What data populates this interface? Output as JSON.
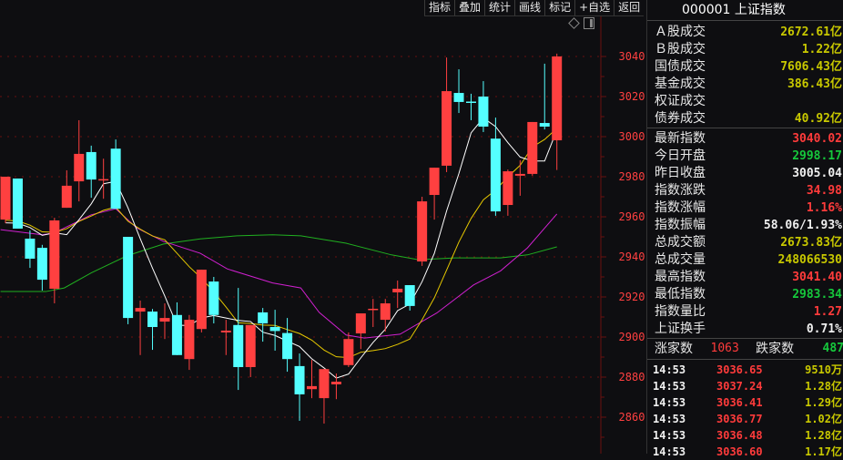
{
  "toolbar": {
    "buttons": [
      "指标",
      "叠加",
      "统计",
      "画线",
      "标记",
      "+自选",
      "返回"
    ]
  },
  "panel": {
    "title": "000001 上证指数",
    "trade_rows": [
      {
        "label": "Ａ股成交",
        "value": "2672.61亿"
      },
      {
        "label": "Ｂ股成交",
        "value": "1.22亿"
      },
      {
        "label": "国债成交",
        "value": "7606.43亿"
      },
      {
        "label": "基金成交",
        "value": "386.43亿"
      },
      {
        "label": "权证成交",
        "value": ""
      },
      {
        "label": "债券成交",
        "value": "40.92亿"
      }
    ],
    "index_rows": [
      {
        "label": "最新指数",
        "value": "3040.02",
        "color": "r"
      },
      {
        "label": "今日开盘",
        "value": "2998.17",
        "color": "g"
      },
      {
        "label": "昨日收盘",
        "value": "3005.04",
        "color": "w"
      },
      {
        "label": "指数涨跌",
        "value": "34.98",
        "color": "r"
      },
      {
        "label": "指数涨幅",
        "value": "1.16%",
        "color": "r"
      },
      {
        "label": "指数振幅",
        "value": "58.06/1.93%",
        "color": "w"
      },
      {
        "label": "总成交额",
        "value": "2673.83亿",
        "color": "y"
      },
      {
        "label": "总成交量",
        "value": "248066530",
        "color": "y"
      },
      {
        "label": "最高指数",
        "value": "3041.40",
        "color": "r"
      },
      {
        "label": "最低指数",
        "value": "2983.34",
        "color": "g"
      },
      {
        "label": "指数量比",
        "value": "1.27",
        "color": "r"
      },
      {
        "label": "上证换手",
        "value": "0.71%",
        "color": "w"
      }
    ],
    "advance_label": "涨家数",
    "advance": "1063",
    "decline_label": "跌家数",
    "decline": "487",
    "ticks": [
      {
        "time": "14:53",
        "price": "3036.65",
        "vol": "9510万"
      },
      {
        "time": "14:53",
        "price": "3037.24",
        "vol": "1.28亿"
      },
      {
        "time": "14:53",
        "price": "3036.41",
        "vol": "1.29亿"
      },
      {
        "time": "14:53",
        "price": "3036.77",
        "vol": "1.02亿"
      },
      {
        "time": "14:53",
        "price": "3036.48",
        "vol": "1.28亿"
      },
      {
        "time": "14:53",
        "price": "3036.60",
        "vol": "1.17亿"
      }
    ]
  },
  "colors": {
    "up": "#ff4040",
    "down": "#54ffff",
    "ma5": "#ffffff",
    "ma10": "#e6c800",
    "ma20": "#d020d0",
    "ma60": "#20b020",
    "grid": "#6a1010",
    "axis": "#ff4040"
  },
  "chart_data": {
    "type": "candlestick",
    "ylim": [
      2850,
      3048
    ],
    "yticks": [
      3040,
      3020,
      3000,
      2980,
      2960,
      2940,
      2920,
      2900,
      2880,
      2860
    ],
    "candles": [
      [
        2958.6,
        2980,
        2980,
        2956.8
      ],
      [
        2979.1,
        2954.1,
        2979.1,
        2954.1
      ],
      [
        2949.1,
        2939.1,
        2953.2,
        2934.5
      ],
      [
        2944.5,
        2928.6,
        2946,
        2923.2
      ],
      [
        2924.1,
        2958.2,
        2959.5,
        2916.8
      ],
      [
        2964.5,
        2975.5,
        2983.2,
        2964.5
      ],
      [
        2977.7,
        2991.4,
        3008.2,
        2967.7
      ],
      [
        2992.3,
        2978.6,
        2995.5,
        2969.5
      ],
      [
        2978.2,
        2978.8,
        2989,
        2969
      ],
      [
        2994,
        2964,
        2998.6,
        2964
      ],
      [
        2950,
        2909.5,
        2950,
        2906.4
      ],
      [
        2912.7,
        2914.5,
        2918.2,
        2891
      ],
      [
        2912.7,
        2905,
        2914,
        2893.6
      ],
      [
        2907.7,
        2909.5,
        2916.8,
        2899
      ],
      [
        2911,
        2891,
        2917.3,
        2891
      ],
      [
        2889,
        2908.6,
        2911,
        2883.6
      ],
      [
        2904,
        2933.6,
        2933.6,
        2902.3
      ],
      [
        2927.7,
        2911,
        2930,
        2906.8
      ],
      [
        2902.3,
        2903.2,
        2908.6,
        2891
      ],
      [
        2906,
        2885,
        2924.5,
        2873.6
      ],
      [
        2885,
        2906,
        2906,
        2880
      ],
      [
        2912.3,
        2906.8,
        2914.5,
        2897.7
      ],
      [
        2905,
        2903,
        2913.6,
        2893.2
      ],
      [
        2902,
        2889,
        2909.5,
        2882.7
      ],
      [
        2885.5,
        2871.4,
        2891.8,
        2858.2
      ],
      [
        2874,
        2875.5,
        2888.6,
        2869.5
      ],
      [
        2869.5,
        2884,
        2884,
        2856.8
      ],
      [
        2876.4,
        2877.7,
        2881.8,
        2869
      ],
      [
        2886,
        2899,
        2902.3,
        2885
      ],
      [
        2901.8,
        2911.8,
        2911.8,
        2894
      ],
      [
        2913.6,
        2914.1,
        2919,
        2905
      ],
      [
        2908.6,
        2916.8,
        2919,
        2902.7
      ],
      [
        2922.3,
        2924.1,
        2928.2,
        2914.5
      ],
      [
        2925.9,
        2915.5,
        2925.9,
        2913.2
      ],
      [
        2937.7,
        2967.7,
        2970,
        2935.5
      ],
      [
        2970.9,
        2984.5,
        2984.5,
        2958.6
      ],
      [
        2985.5,
        3022.7,
        3039.5,
        2982.3
      ],
      [
        3021.8,
        3017.3,
        3033.6,
        3011.8
      ],
      [
        3017.5,
        3017.3,
        3021.4,
        3008.2
      ],
      [
        3020,
        3005,
        3027.7,
        3002.3
      ],
      [
        2999,
        2962.7,
        3009.5,
        2960.5
      ],
      [
        2965.9,
        2982.7,
        2983.6,
        2960.5
      ],
      [
        2980.5,
        2981.4,
        2988.2,
        2970.5
      ],
      [
        2981.4,
        3007.3,
        3007.3,
        2980.5
      ],
      [
        3006.8,
        3005,
        3036.4,
        3003.6
      ],
      [
        2998.17,
        3040.02,
        3041.4,
        2983.34
      ]
    ],
    "ma20": [
      [
        -0.4,
        2953.6
      ],
      [
        3,
        2951
      ],
      [
        4,
        2952
      ],
      [
        7,
        2961
      ],
      [
        9,
        2964
      ],
      [
        10.7,
        2954.5
      ],
      [
        12.9,
        2947.7
      ],
      [
        15.9,
        2941.8
      ],
      [
        18.1,
        2934
      ],
      [
        21.8,
        2927
      ],
      [
        24.1,
        2924.5
      ],
      [
        25.6,
        2912.3
      ],
      [
        27.8,
        2901
      ],
      [
        29.3,
        2899.5
      ],
      [
        32.2,
        2901.4
      ],
      [
        35.2,
        2912
      ],
      [
        38.2,
        2926
      ],
      [
        40.4,
        2933
      ],
      [
        42.6,
        2944.5
      ],
      [
        45,
        2961.4
      ]
    ],
    "ma60": [
      [
        -0.4,
        2922.7
      ],
      [
        3.3,
        2922.7
      ],
      [
        4.8,
        2924.5
      ],
      [
        7,
        2932
      ],
      [
        9.9,
        2940.5
      ],
      [
        12.9,
        2946.4
      ],
      [
        15.9,
        2949
      ],
      [
        18.9,
        2950.5
      ],
      [
        21.8,
        2951
      ],
      [
        24.1,
        2950.5
      ],
      [
        27.8,
        2946.8
      ],
      [
        31.5,
        2941
      ],
      [
        33.7,
        2938.6
      ],
      [
        36.7,
        2939.5
      ],
      [
        40.4,
        2939.5
      ],
      [
        42.6,
        2941
      ],
      [
        45,
        2945
      ]
    ],
    "ma5_prior": [
      2962,
      2955,
      2950,
      2948,
      2952
    ],
    "ma10_prior": [
      2955,
      2958,
      2960,
      2962,
      2960,
      2958,
      2955,
      2952,
      2950,
      2948
    ]
  }
}
